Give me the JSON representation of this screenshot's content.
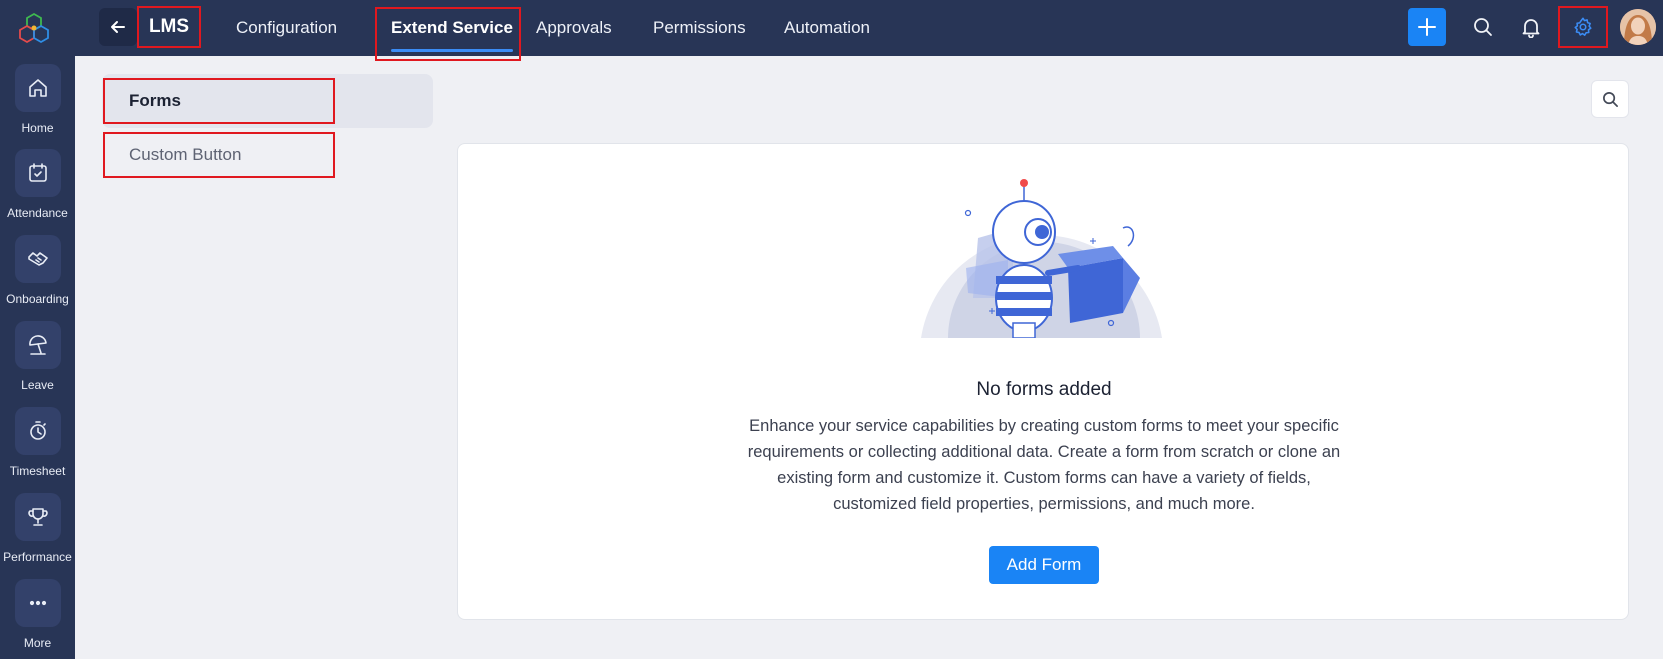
{
  "rail": {
    "items": [
      {
        "label": "Home",
        "icon": "home-icon"
      },
      {
        "label": "Attendance",
        "icon": "calendar-check-icon"
      },
      {
        "label": "Onboarding",
        "icon": "handshake-icon"
      },
      {
        "label": "Leave",
        "icon": "beach-umbrella-icon"
      },
      {
        "label": "Timesheet",
        "icon": "stopwatch-icon"
      },
      {
        "label": "Performance",
        "icon": "trophy-icon"
      },
      {
        "label": "More",
        "icon": "more-dots-icon"
      }
    ]
  },
  "topbar": {
    "brand": "LMS",
    "tabs": [
      {
        "label": "Configuration",
        "active": false
      },
      {
        "label": "Extend Service",
        "active": true
      },
      {
        "label": "Approvals",
        "active": false
      },
      {
        "label": "Permissions",
        "active": false
      },
      {
        "label": "Automation",
        "active": false
      }
    ]
  },
  "side_menu": {
    "items": [
      {
        "label": "Forms",
        "active": true
      },
      {
        "label": "Custom Button",
        "active": false
      }
    ]
  },
  "empty_state": {
    "title": "No forms added",
    "description": "Enhance your service capabilities by creating custom forms to meet your specific requirements or collecting additional data. Create a form from scratch or clone an existing form and customize it. Custom forms can have a variety of fields, customized field properties, permissions, and much more.",
    "button_label": "Add Form"
  },
  "colors": {
    "nav_bg": "#283556",
    "accent": "#1a84f5",
    "highlight": "#e0181f",
    "page_bg": "#eff0f4"
  }
}
